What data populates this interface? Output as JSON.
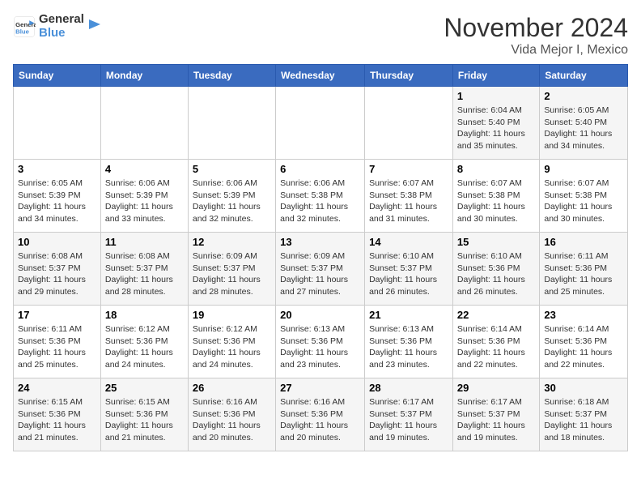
{
  "header": {
    "logo_line1": "General",
    "logo_line2": "Blue",
    "month": "November 2024",
    "location": "Vida Mejor I, Mexico"
  },
  "days_of_week": [
    "Sunday",
    "Monday",
    "Tuesday",
    "Wednesday",
    "Thursday",
    "Friday",
    "Saturday"
  ],
  "weeks": [
    [
      {
        "day": "",
        "info": ""
      },
      {
        "day": "",
        "info": ""
      },
      {
        "day": "",
        "info": ""
      },
      {
        "day": "",
        "info": ""
      },
      {
        "day": "",
        "info": ""
      },
      {
        "day": "1",
        "info": "Sunrise: 6:04 AM\nSunset: 5:40 PM\nDaylight: 11 hours and 35 minutes."
      },
      {
        "day": "2",
        "info": "Sunrise: 6:05 AM\nSunset: 5:40 PM\nDaylight: 11 hours and 34 minutes."
      }
    ],
    [
      {
        "day": "3",
        "info": "Sunrise: 6:05 AM\nSunset: 5:39 PM\nDaylight: 11 hours and 34 minutes."
      },
      {
        "day": "4",
        "info": "Sunrise: 6:06 AM\nSunset: 5:39 PM\nDaylight: 11 hours and 33 minutes."
      },
      {
        "day": "5",
        "info": "Sunrise: 6:06 AM\nSunset: 5:39 PM\nDaylight: 11 hours and 32 minutes."
      },
      {
        "day": "6",
        "info": "Sunrise: 6:06 AM\nSunset: 5:38 PM\nDaylight: 11 hours and 32 minutes."
      },
      {
        "day": "7",
        "info": "Sunrise: 6:07 AM\nSunset: 5:38 PM\nDaylight: 11 hours and 31 minutes."
      },
      {
        "day": "8",
        "info": "Sunrise: 6:07 AM\nSunset: 5:38 PM\nDaylight: 11 hours and 30 minutes."
      },
      {
        "day": "9",
        "info": "Sunrise: 6:07 AM\nSunset: 5:38 PM\nDaylight: 11 hours and 30 minutes."
      }
    ],
    [
      {
        "day": "10",
        "info": "Sunrise: 6:08 AM\nSunset: 5:37 PM\nDaylight: 11 hours and 29 minutes."
      },
      {
        "day": "11",
        "info": "Sunrise: 6:08 AM\nSunset: 5:37 PM\nDaylight: 11 hours and 28 minutes."
      },
      {
        "day": "12",
        "info": "Sunrise: 6:09 AM\nSunset: 5:37 PM\nDaylight: 11 hours and 28 minutes."
      },
      {
        "day": "13",
        "info": "Sunrise: 6:09 AM\nSunset: 5:37 PM\nDaylight: 11 hours and 27 minutes."
      },
      {
        "day": "14",
        "info": "Sunrise: 6:10 AM\nSunset: 5:37 PM\nDaylight: 11 hours and 26 minutes."
      },
      {
        "day": "15",
        "info": "Sunrise: 6:10 AM\nSunset: 5:36 PM\nDaylight: 11 hours and 26 minutes."
      },
      {
        "day": "16",
        "info": "Sunrise: 6:11 AM\nSunset: 5:36 PM\nDaylight: 11 hours and 25 minutes."
      }
    ],
    [
      {
        "day": "17",
        "info": "Sunrise: 6:11 AM\nSunset: 5:36 PM\nDaylight: 11 hours and 25 minutes."
      },
      {
        "day": "18",
        "info": "Sunrise: 6:12 AM\nSunset: 5:36 PM\nDaylight: 11 hours and 24 minutes."
      },
      {
        "day": "19",
        "info": "Sunrise: 6:12 AM\nSunset: 5:36 PM\nDaylight: 11 hours and 24 minutes."
      },
      {
        "day": "20",
        "info": "Sunrise: 6:13 AM\nSunset: 5:36 PM\nDaylight: 11 hours and 23 minutes."
      },
      {
        "day": "21",
        "info": "Sunrise: 6:13 AM\nSunset: 5:36 PM\nDaylight: 11 hours and 23 minutes."
      },
      {
        "day": "22",
        "info": "Sunrise: 6:14 AM\nSunset: 5:36 PM\nDaylight: 11 hours and 22 minutes."
      },
      {
        "day": "23",
        "info": "Sunrise: 6:14 AM\nSunset: 5:36 PM\nDaylight: 11 hours and 22 minutes."
      }
    ],
    [
      {
        "day": "24",
        "info": "Sunrise: 6:15 AM\nSunset: 5:36 PM\nDaylight: 11 hours and 21 minutes."
      },
      {
        "day": "25",
        "info": "Sunrise: 6:15 AM\nSunset: 5:36 PM\nDaylight: 11 hours and 21 minutes."
      },
      {
        "day": "26",
        "info": "Sunrise: 6:16 AM\nSunset: 5:36 PM\nDaylight: 11 hours and 20 minutes."
      },
      {
        "day": "27",
        "info": "Sunrise: 6:16 AM\nSunset: 5:36 PM\nDaylight: 11 hours and 20 minutes."
      },
      {
        "day": "28",
        "info": "Sunrise: 6:17 AM\nSunset: 5:37 PM\nDaylight: 11 hours and 19 minutes."
      },
      {
        "day": "29",
        "info": "Sunrise: 6:17 AM\nSunset: 5:37 PM\nDaylight: 11 hours and 19 minutes."
      },
      {
        "day": "30",
        "info": "Sunrise: 6:18 AM\nSunset: 5:37 PM\nDaylight: 11 hours and 18 minutes."
      }
    ]
  ]
}
